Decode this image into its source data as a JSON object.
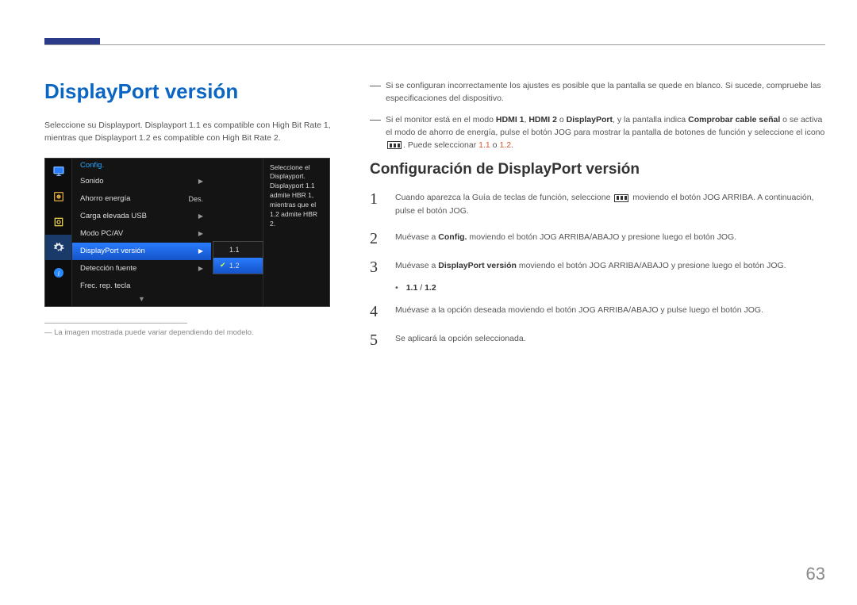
{
  "title": "DisplayPort versión",
  "intro": "Seleccione su Displayport. Displayport 1.1 es compatible con High Bit Rate 1, mientras que Displayport 1.2 es compatible con High Bit Rate 2.",
  "osd": {
    "header": "Config.",
    "items": [
      {
        "label": "Sonido",
        "value": "",
        "arrow": true
      },
      {
        "label": "Ahorro energía",
        "value": "Des.",
        "arrow": false
      },
      {
        "label": "Carga elevada USB",
        "value": "",
        "arrow": true
      },
      {
        "label": "Modo PC/AV",
        "value": "",
        "arrow": true
      },
      {
        "label": "DisplayPort versión",
        "value": "",
        "arrow": true,
        "selected": true
      },
      {
        "label": "Detección fuente",
        "value": "",
        "arrow": true
      },
      {
        "label": "Frec. rep. tecla",
        "value": "",
        "arrow": false
      }
    ],
    "submenu": [
      {
        "label": "1.1"
      },
      {
        "label": "1.2",
        "selected": true,
        "checked": true
      }
    ],
    "info": "Seleccione el Displayport. Displayport 1.1 admite HBR 1, mientras que el 1.2 admite HBR 2."
  },
  "footnote": "La imagen mostrada puede variar dependiendo del modelo.",
  "notes": {
    "n1": "Si se configuran incorrectamente los ajustes es posible que la pantalla se quede en blanco. Si sucede, compruebe las especificaciones del dispositivo.",
    "n2_a": "Si el monitor está en el modo ",
    "n2_b": "HDMI 1",
    "n2_c": ", ",
    "n2_d": "HDMI 2",
    "n2_e": " o ",
    "n2_f": "DisplayPort",
    "n2_g": ", y la pantalla indica ",
    "n2_h": "Comprobar cable señal",
    "n2_i": " o se activa el modo de ahorro de energía, pulse el botón JOG para mostrar la pantalla de botones de función y seleccione el icono ",
    "n2_j": ". Puede seleccionar ",
    "n2_k": "1.1",
    "n2_l": " o ",
    "n2_m": "1.2",
    "n2_n": "."
  },
  "subTitle": "Configuración de DisplayPort versión",
  "steps": {
    "s1_a": "Cuando aparezca la Guía de teclas de función, seleccione ",
    "s1_b": " moviendo el botón JOG ARRIBA. A continuación, pulse el botón JOG.",
    "s2_a": "Muévase a ",
    "s2_b": "Config.",
    "s2_c": " moviendo el botón JOG ARRIBA/ABAJO y presione luego el botón JOG.",
    "s3_a": "Muévase a ",
    "s3_b": "DisplayPort versión",
    "s3_c": " moviendo el botón JOG ARRIBA/ABAJO y presione luego el botón JOG.",
    "bullet_a": "1.1",
    "bullet_sep": " / ",
    "bullet_b": "1.2",
    "s4": "Muévase a la opción deseada moviendo el botón JOG ARRIBA/ABAJO y pulse luego el botón JOG.",
    "s5": "Se aplicará la opción seleccionada."
  },
  "pageNumber": "63"
}
